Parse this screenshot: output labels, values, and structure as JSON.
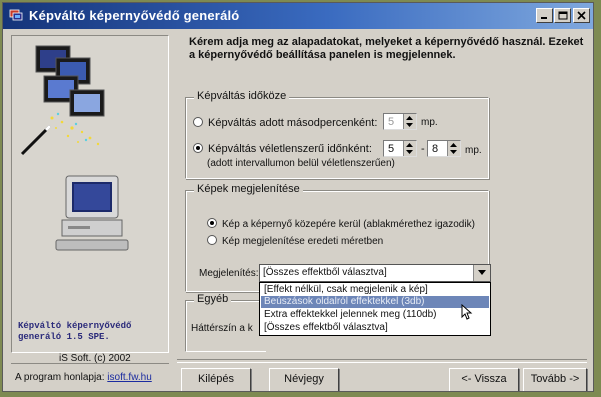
{
  "window": {
    "title": "Képváltó képernyővédő generáló",
    "icon": "app-icon",
    "controls": [
      "minimize-icon",
      "maximize-icon",
      "close-icon"
    ]
  },
  "left_panel": {
    "product_line1": "Képváltó képernyővédő",
    "product_line2": "generáló  1.5 SPE.",
    "copyright": "iS Soft. (c) 2002",
    "homepage_label": "A program honlapja:",
    "homepage_link": "isoft.fw.hu"
  },
  "intro": "Kérem adja meg az alapadatokat, melyeket a képernyővédő használ. Ezeket a képernyővédő beállítása panelen is megjelennek.",
  "interval_group": {
    "title": "Képváltás időköze",
    "option_fixed": "Képváltás adott másodpercenként:",
    "fixed_value": "5",
    "fixed_unit": "mp.",
    "option_random": "Képváltás véletlenszerű időnként:",
    "random_sub": "(adott intervallumon belül véletlenszerűen)",
    "random_min": "5",
    "random_sep": "-",
    "random_max": "8",
    "random_unit": "mp.",
    "selected": "random"
  },
  "display_group": {
    "title": "Képek megjelenítése",
    "option_center": "Kép a képernyő közepére kerül  (ablakmérethez igazodik)",
    "option_original": "Kép megjelenítése eredeti méretben",
    "selected": "center",
    "effect_label": "Megjelenítés:",
    "effect_value": "[Összes effektből választva]",
    "effect_options": [
      "[Effekt nélkül, csak megjelenik a kép]",
      "Beúszások oldalról effektekkel (3db)",
      "Extra effektekkel jelennek meg (110db)",
      "[Összes effektből választva]"
    ],
    "highlighted_index": 1
  },
  "other_group": {
    "title": "Egyéb",
    "background_label": "Háttérszín a k"
  },
  "buttons": {
    "exit": "Kilépés",
    "about": "Névjegy",
    "back": "<- Vissza",
    "next": "Tovább ->"
  }
}
